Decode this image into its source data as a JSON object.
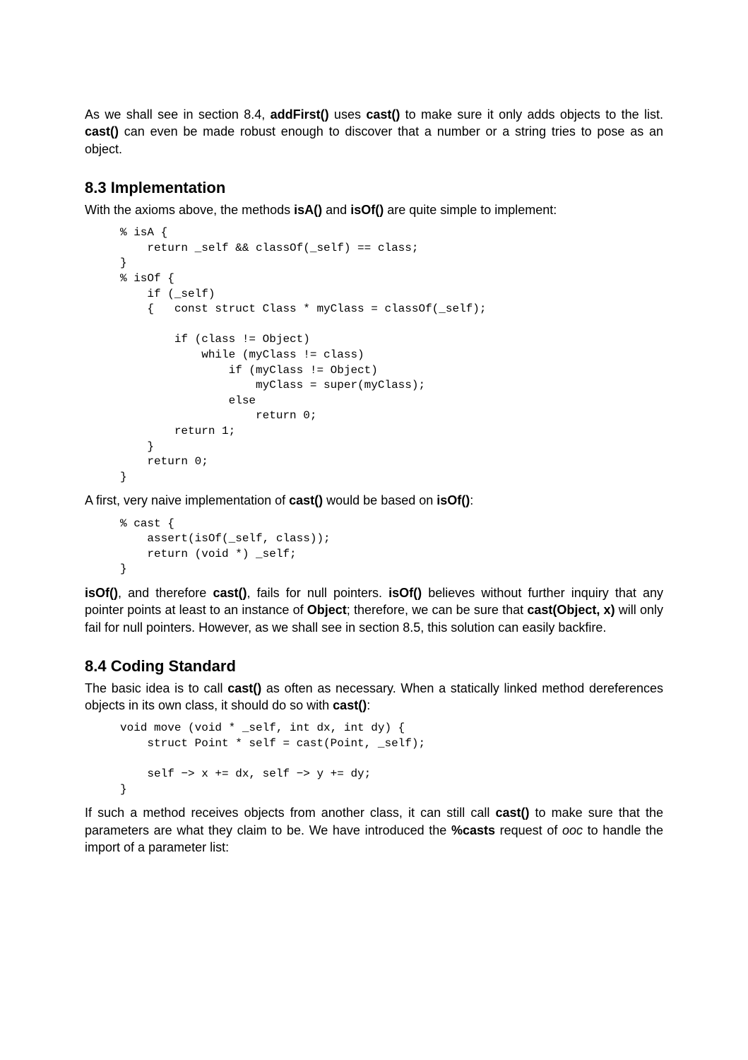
{
  "intro": {
    "p1_seg1": "As we shall see in section 8.4, ",
    "p1_bold1": "addFirst()",
    "p1_seg2": " uses ",
    "p1_bold2": "cast()",
    "p1_seg3": " to make sure it only adds objects to the list. ",
    "p1_bold3": "cast()",
    "p1_seg4": " can even be made robust enough to discover that a number or a string tries to pose as an object."
  },
  "sec83": {
    "heading": "8.3 Implementation",
    "p1_seg1": "With the axioms above, the methods ",
    "p1_bold1": "isA()",
    "p1_seg2": " and ",
    "p1_bold2": "isOf()",
    "p1_seg3": " are quite simple to implement:",
    "code1": "% isA {\n    return _self && classOf(_self) == class;\n}\n% isOf {\n    if (_self)\n    {   const struct Class * myClass = classOf(_self);\n\n        if (class != Object)\n            while (myClass != class)\n                if (myClass != Object)\n                    myClass = super(myClass);\n                else\n                    return 0;\n        return 1;\n    }\n    return 0;\n}",
    "p2_seg1": "A first, very naive implementation of ",
    "p2_bold1": "cast()",
    "p2_seg2": " would be based on ",
    "p2_bold2": "isOf()",
    "p2_seg3": ":",
    "code2": "% cast {\n    assert(isOf(_self, class));\n    return (void *) _self;\n}",
    "p3_bold1": "isOf()",
    "p3_seg1": ", and therefore ",
    "p3_bold2": "cast()",
    "p3_seg2": ", fails for null pointers. ",
    "p3_bold3": "isOf()",
    "p3_seg3": " believes without further inquiry that any pointer points at least to an instance of ",
    "p3_bold4": "Object",
    "p3_seg4": "; therefore, we can be sure that ",
    "p3_bold5": "cast(Object, x)",
    "p3_seg5": " will only fail for null pointers. However, as we shall see in section 8.5, this solution can easily backfire."
  },
  "sec84": {
    "heading": "8.4 Coding Standard",
    "p1_seg1": "The basic idea is to call ",
    "p1_bold1": "cast()",
    "p1_seg2": " as often as necessary. When a statically linked method dereferences objects in its own class, it should do so with ",
    "p1_bold2": "cast()",
    "p1_seg3": ":",
    "code1": "void move (void * _self, int dx, int dy) {\n    struct Point * self = cast(Point, _self);\n\n    self −> x += dx, self −> y += dy;\n}",
    "p2_seg1": "If such a method receives objects from another class, it can still call ",
    "p2_bold1": "cast()",
    "p2_seg2": " to make sure that the parameters are what they claim to be. We have introduced the ",
    "p2_bold2": "%casts",
    "p2_seg3": " request of ",
    "p2_italic1": "ooc",
    "p2_seg4": " to handle the import of a parameter list:"
  }
}
